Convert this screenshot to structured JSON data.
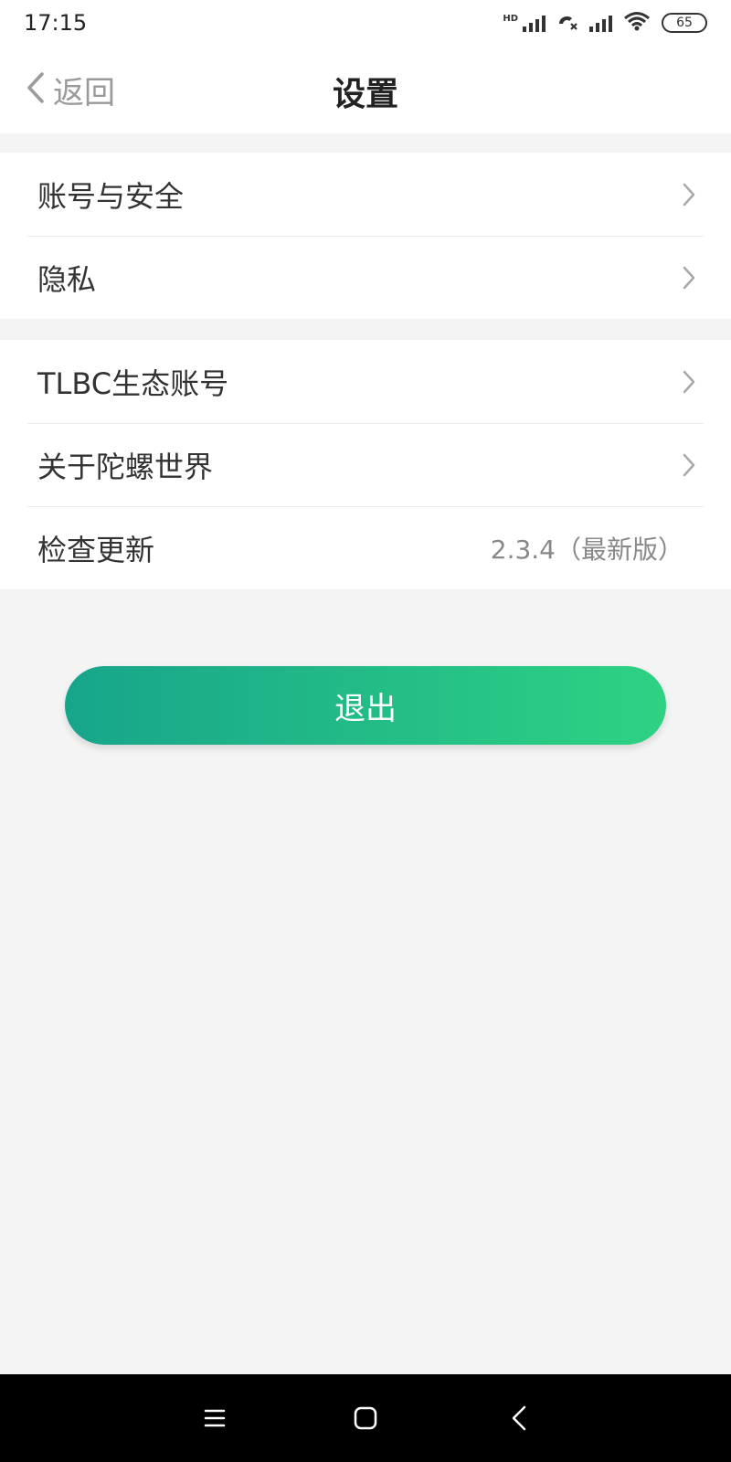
{
  "status_bar": {
    "time": "17:15",
    "network_label": "HD",
    "battery": "65",
    "icons": [
      "signal-icon",
      "call-icon",
      "signal-icon",
      "wifi-icon",
      "battery-icon"
    ]
  },
  "header": {
    "back_label": "返回",
    "title": "设置"
  },
  "groups": [
    {
      "items": [
        {
          "label": "账号与安全",
          "icon": "chevron-right-icon"
        },
        {
          "label": "隐私",
          "icon": "chevron-right-icon"
        }
      ]
    },
    {
      "items": [
        {
          "label": "TLBC生态账号",
          "icon": "chevron-right-icon"
        },
        {
          "label": "关于陀螺世界",
          "icon": "chevron-right-icon"
        },
        {
          "label": "检查更新",
          "value": "2.3.4（最新版）"
        }
      ]
    }
  ],
  "logout": {
    "label": "退出"
  },
  "colors": {
    "accent_start": "#17a58a",
    "accent_end": "#2ed283",
    "background": "#f4f4f4"
  },
  "system_nav": {
    "buttons": [
      "menu-icon",
      "home-icon",
      "back-icon"
    ]
  }
}
